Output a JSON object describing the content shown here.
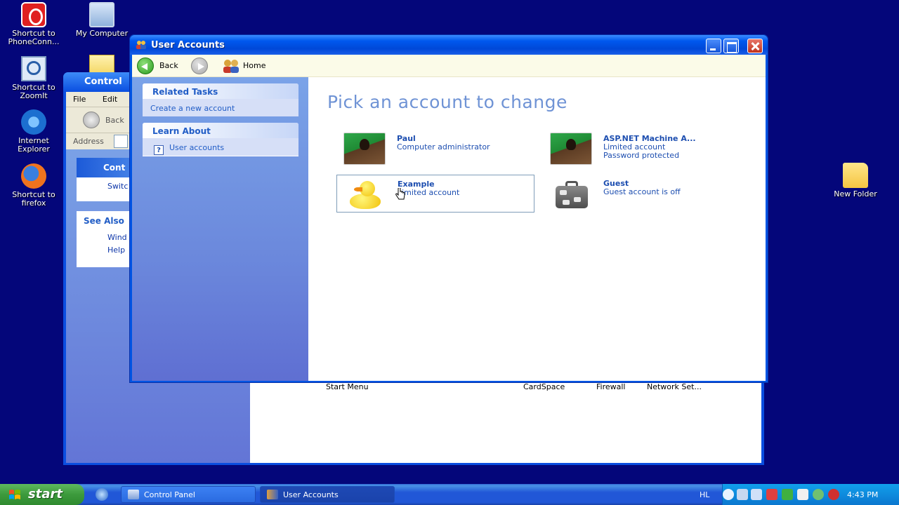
{
  "desktop": {
    "icons": [
      {
        "label": "Shortcut to PhoneConn..."
      },
      {
        "label": "My Computer"
      },
      {
        "label": "Shortcut to ZoomIt"
      },
      {
        "label": "Internet Explorer"
      },
      {
        "label": "Shortcut to firefox"
      },
      {
        "label": "New Folder"
      }
    ]
  },
  "control_panel": {
    "title": "Control",
    "menu": [
      "File",
      "Edit"
    ],
    "back_label": "Back",
    "address_label": "Address",
    "panel1": {
      "head": "Cont",
      "item": "Switc"
    },
    "panel2": {
      "head": "See Also",
      "items": [
        "Wind",
        "Help"
      ]
    },
    "bottom_labels": [
      "Start Menu",
      "CardSpace",
      "Firewall",
      "Network Set..."
    ]
  },
  "user_accounts": {
    "title": "User Accounts",
    "nav": {
      "back": "Back",
      "home": "Home"
    },
    "related_tasks": {
      "head": "Related Tasks",
      "items": [
        "Create a new account"
      ]
    },
    "learn_about": {
      "head": "Learn About",
      "items": [
        "User accounts"
      ]
    },
    "heading": "Pick an account to change",
    "accounts": [
      {
        "name": "Paul",
        "lines": [
          "Computer administrator"
        ]
      },
      {
        "name": "ASP.NET Machine A...",
        "lines": [
          "Limited account",
          "Password protected"
        ]
      },
      {
        "name": "Example",
        "lines": [
          "Limited account"
        ]
      },
      {
        "name": "Guest",
        "lines": [
          "Guest account is off"
        ]
      }
    ]
  },
  "taskbar": {
    "start": "start",
    "tasks": [
      {
        "label": "Control Panel"
      },
      {
        "label": "User Accounts"
      }
    ],
    "language": "HL",
    "clock": "4:43 PM"
  }
}
